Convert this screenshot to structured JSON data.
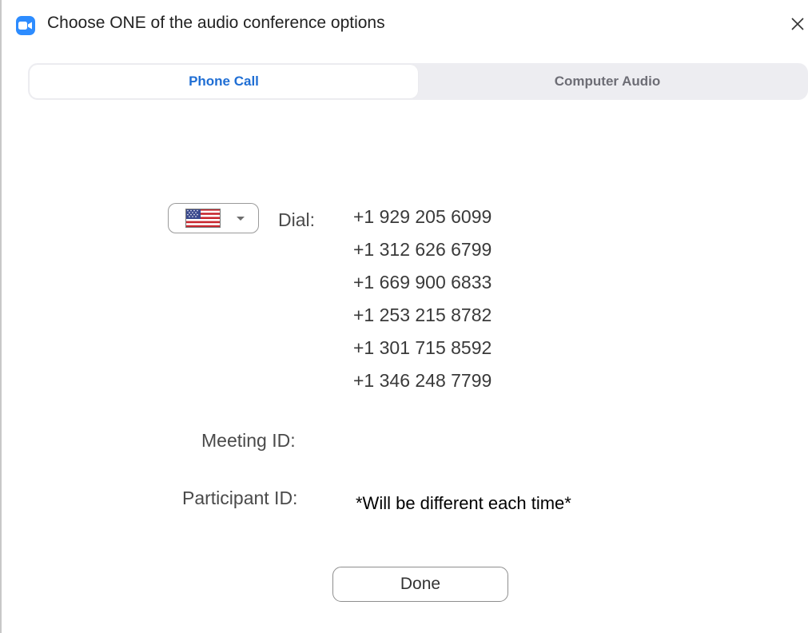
{
  "window": {
    "title": "Choose ONE of the audio conference options",
    "app_icon": "zoom-video-icon",
    "close_icon": "close-icon"
  },
  "tabs": [
    {
      "label": "Phone Call",
      "selected": true
    },
    {
      "label": "Computer Audio",
      "selected": false
    }
  ],
  "dial": {
    "country_icon": "us-flag-icon",
    "label": "Dial:",
    "numbers": [
      "+1 929 205 6099",
      "+1 312 626 6799",
      "+1 669 900 6833",
      "+1 253 215 8782",
      "+1 301 715 8592",
      "+1 346 248 7799"
    ]
  },
  "meeting_id": {
    "label": "Meeting ID:",
    "value": ""
  },
  "participant_id": {
    "label": "Participant ID:",
    "value": "*Will be different each time*"
  },
  "done_label": "Done",
  "colors": {
    "accent": "#1f6ed4",
    "zoom_blue": "#2d8cff",
    "tab_track": "#ededf1"
  }
}
